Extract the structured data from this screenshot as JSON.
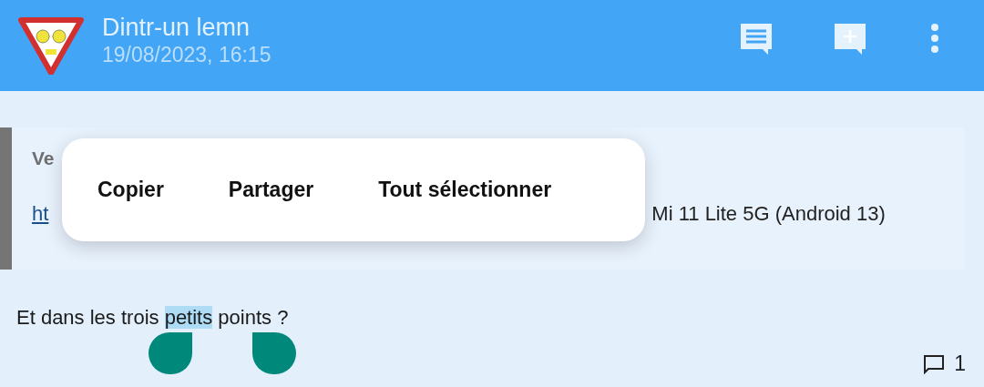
{
  "header": {
    "title": "Dintr-un lemn",
    "subtitle": "19/08/2023, 16:15"
  },
  "quote": {
    "author": "Ve",
    "link": "ht",
    "text": "Mi 11 Lite 5G (Android 13)"
  },
  "message": {
    "segments": [
      {
        "text": "Et dans les trois ",
        "selected": false
      },
      {
        "text": "petits",
        "selected": true
      },
      {
        "text": " points ?",
        "selected": false
      }
    ]
  },
  "comments": {
    "count": "1"
  },
  "context_menu": {
    "items": [
      "Copier",
      "Partager",
      "Tout sélectionner"
    ]
  }
}
